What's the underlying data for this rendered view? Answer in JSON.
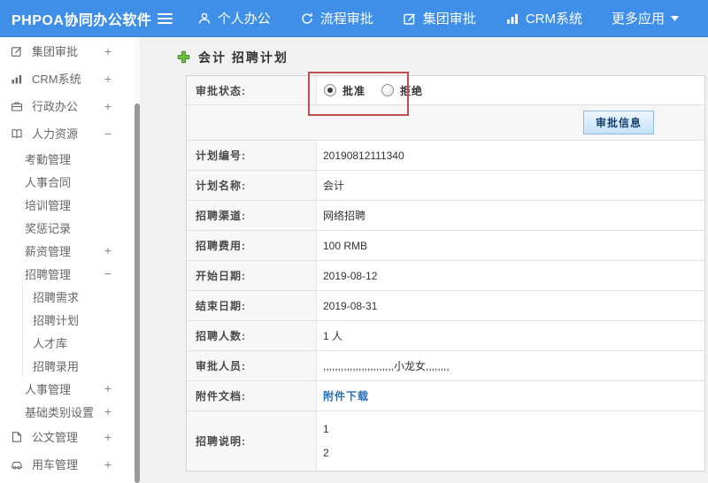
{
  "navbar": {
    "brand": "PHPOA协同办公软件",
    "items": [
      {
        "label": "个人办公",
        "icon": "user-icon"
      },
      {
        "label": "流程审批",
        "icon": "refresh-arrow-icon"
      },
      {
        "label": "集团审批",
        "icon": "edit-square-icon"
      },
      {
        "label": "CRM系统",
        "icon": "bar-chart-icon"
      },
      {
        "label": "更多应用",
        "icon": "caret-down-icon"
      }
    ]
  },
  "sidebar": {
    "items": [
      {
        "label": "集团审批",
        "toggle": "+",
        "icon": "edit-square-icon",
        "level": 1
      },
      {
        "label": "CRM系统",
        "toggle": "+",
        "icon": "bar-chart-icon",
        "level": 1
      },
      {
        "label": "行政办公",
        "toggle": "+",
        "icon": "briefcase-icon",
        "level": 1
      },
      {
        "label": "人力资源",
        "toggle": "−",
        "icon": "book-icon",
        "level": 1
      },
      {
        "label": "考勤管理",
        "level": 2
      },
      {
        "label": "人事合同",
        "level": 2
      },
      {
        "label": "培训管理",
        "level": 2
      },
      {
        "label": "奖惩记录",
        "level": 2
      },
      {
        "label": "薪资管理",
        "toggle": "+",
        "level": 2
      },
      {
        "label": "招聘管理",
        "toggle": "−",
        "level": 2
      },
      {
        "label": "招聘需求",
        "level": 3
      },
      {
        "label": "招聘计划",
        "level": 3
      },
      {
        "label": "人才库",
        "level": 3
      },
      {
        "label": "招聘录用",
        "level": 3
      },
      {
        "label": "人事管理",
        "toggle": "+",
        "level": 2
      },
      {
        "label": "基础类别设置",
        "toggle": "+",
        "level": 2
      },
      {
        "label": "公文管理",
        "toggle": "+",
        "icon": "document-icon",
        "level": 1
      },
      {
        "label": "用车管理",
        "toggle": "+",
        "icon": "car-icon",
        "level": 1
      }
    ]
  },
  "main": {
    "title": "会计 招聘计划",
    "approval": {
      "status_label": "审批状态:",
      "options": [
        {
          "label": "批准",
          "selected": true
        },
        {
          "label": "拒绝",
          "selected": false
        }
      ],
      "submit_label": "审批信息"
    },
    "fields": [
      {
        "label": "计划编号:",
        "value": "20190812111340"
      },
      {
        "label": "计划名称:",
        "value": "会计"
      },
      {
        "label": "招聘渠道:",
        "value": "网络招聘"
      },
      {
        "label": "招聘费用:",
        "value": "100 RMB"
      },
      {
        "label": "开始日期:",
        "value": "2019-08-12"
      },
      {
        "label": "结束日期:",
        "value": "2019-08-31"
      },
      {
        "label": "招聘人数:",
        "value": "1 人"
      },
      {
        "label": "审批人员:",
        "value": ",,,,,,,,,,,,,,,,,,,,,,,,小龙女,,,,,,,,"
      },
      {
        "label": "附件文档:",
        "value": "附件下载",
        "type": "link"
      },
      {
        "label": "招聘说明:",
        "lines": [
          "1",
          "2"
        ]
      }
    ]
  },
  "colors": {
    "navbar_bg": "#3f8fe8",
    "link_blue": "#2e6eb5",
    "annotation_red": "#c0504f",
    "button_text_blue": "#16436e",
    "title_plus_green": "#6fc13e",
    "sidebar_text": "#666666"
  }
}
